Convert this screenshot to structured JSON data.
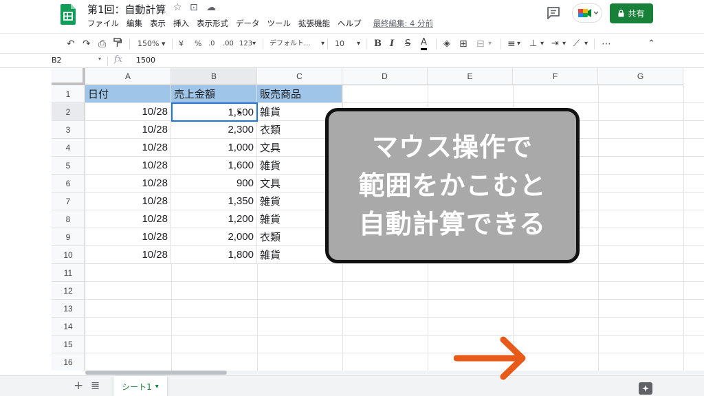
{
  "title": {
    "doc_name": "第1回：自動計算",
    "star_icon": "☆",
    "folder_icon": "⊡",
    "cloud_icon": "☁",
    "last_edit": "最終編集: 4 分前",
    "share_label": "共有",
    "share_lock_icon": "🔒"
  },
  "menus": [
    "ファイル",
    "編集",
    "表示",
    "挿入",
    "表示形式",
    "データ",
    "ツール",
    "拡張機能",
    "ヘルプ"
  ],
  "toolbar": {
    "undo": "↶",
    "redo": "↷",
    "print": "⎙",
    "paint_format": "🖌",
    "zoom": "150%",
    "currency": "¥",
    "percent": "%",
    "decrease_decimal": ".0",
    "increase_decimal": ".00",
    "more_formats": "123",
    "font": "デフォルト...",
    "font_size": "10",
    "bold": "B",
    "italic": "I",
    "strike": "S",
    "text_color": "A",
    "fill": "◈",
    "borders": "⊞",
    "merge": "⊟",
    "align": "≡",
    "valign": "⊥",
    "wrap": "⇥",
    "rotate": "⟋",
    "more": "⋯",
    "collapse": "⌃",
    "dropdown": "▾"
  },
  "formula_bar": {
    "name_box": "B2",
    "fx": "fx",
    "value": "1500"
  },
  "columns": [
    "A",
    "B",
    "C",
    "D",
    "E",
    "F",
    "G"
  ],
  "rows": [
    "1",
    "2",
    "3",
    "4",
    "5",
    "6",
    "7",
    "8",
    "9",
    "10",
    "11",
    "12",
    "13",
    "14",
    "15",
    "16"
  ],
  "table": {
    "headers": [
      "日付",
      "売上金額",
      "販売商品"
    ],
    "data": [
      [
        "10/28",
        "1,500",
        "雑貨"
      ],
      [
        "10/28",
        "2,300",
        "衣類"
      ],
      [
        "10/28",
        "1,000",
        "文具"
      ],
      [
        "10/28",
        "1,600",
        "雑貨"
      ],
      [
        "10/28",
        "900",
        "文具"
      ],
      [
        "10/28",
        "1,350",
        "雑貨"
      ],
      [
        "10/28",
        "1,200",
        "雑貨"
      ],
      [
        "10/28",
        "2,000",
        "衣類"
      ],
      [
        "10/28",
        "1,800",
        "雑貨"
      ]
    ]
  },
  "callout": {
    "lines": [
      "マウス操作で",
      "範囲をかこむと",
      "自動計算できる"
    ]
  },
  "sheets": {
    "add_icon": "+",
    "list_icon": "≣",
    "active_tab": "シート1",
    "tab_arrow": "▾"
  },
  "colors": {
    "header_fill": "#9fc5e8",
    "selection": "#1a73e8",
    "share_green": "#188038",
    "arrow_orange": "#e85a1a",
    "callout_fill": "#a9a9a9"
  }
}
